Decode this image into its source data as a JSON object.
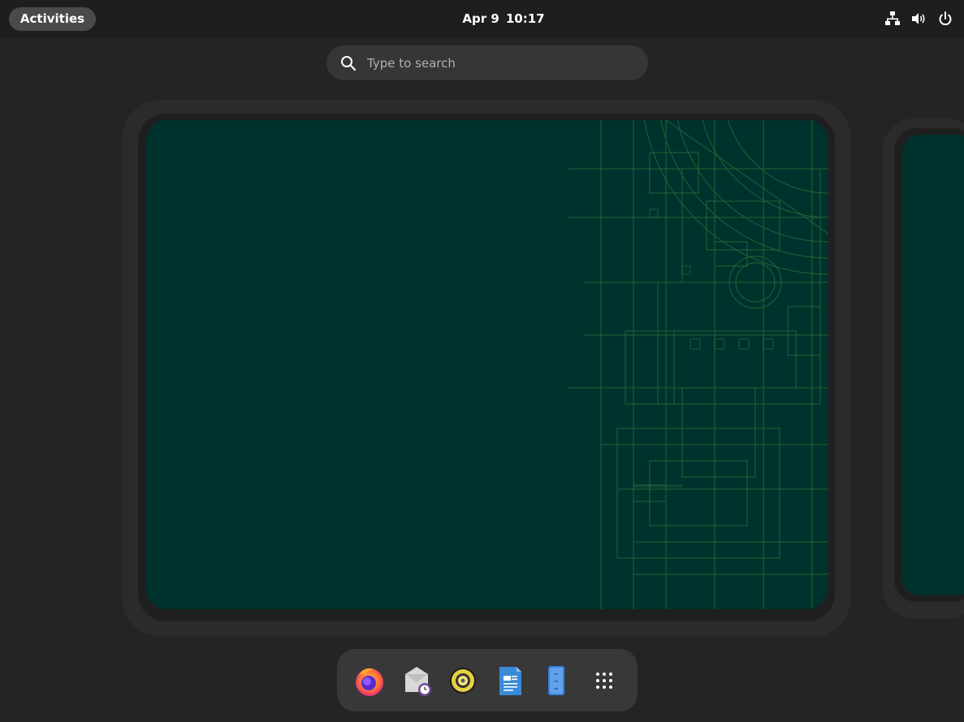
{
  "topbar": {
    "activities_label": "Activities",
    "date": "Apr 9",
    "time": "10:17",
    "status_icons": [
      "network-wired-icon",
      "volume-icon",
      "power-icon"
    ]
  },
  "search": {
    "placeholder": "Type to search",
    "value": ""
  },
  "dock": {
    "apps": [
      {
        "name": "Firefox",
        "icon": "firefox-icon"
      },
      {
        "name": "Evolution Mail",
        "icon": "mail-clock-icon"
      },
      {
        "name": "Rhythmbox",
        "icon": "speaker-icon"
      },
      {
        "name": "LibreOffice Writer",
        "icon": "writer-document-icon"
      },
      {
        "name": "Files",
        "icon": "file-cabinet-icon"
      },
      {
        "name": "Show Applications",
        "icon": "app-grid-icon"
      }
    ]
  },
  "colors": {
    "background": "#242424",
    "topbar": "#1e1e1e",
    "wallpaper": "#00322d",
    "wallpaper_lines": "#3a7a3a",
    "dock": "#383838"
  }
}
